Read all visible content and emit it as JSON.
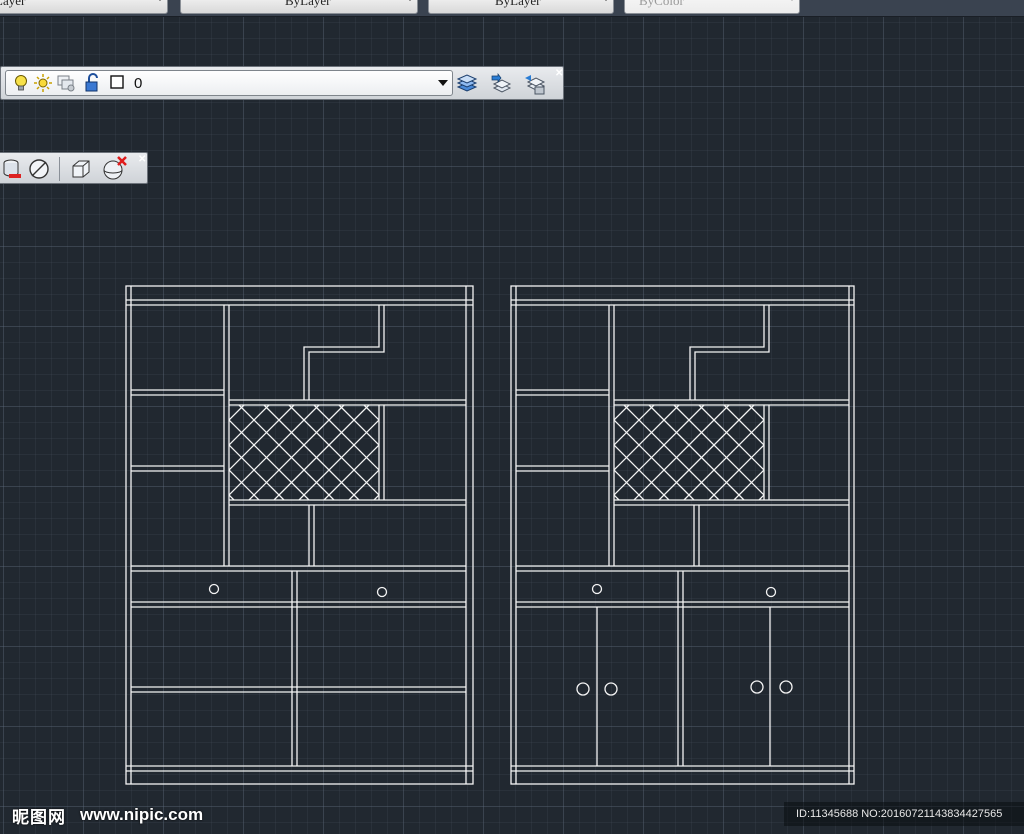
{
  "properties_bar": {
    "color_combo": "Layer",
    "linetype_combo": "ByLayer",
    "lineweight_combo": "ByLayer",
    "plotstyle_combo": "ByColor"
  },
  "layers_toolbar": {
    "current_layer": "0",
    "icons": [
      "layer-on-bulb-icon",
      "thaw-sun-icon",
      "viewport-freeze-icon",
      "lock-open-icon",
      "layer-color-swatch-icon"
    ],
    "buttons": [
      "layer-properties-manager-icon",
      "make-object-layer-current-icon",
      "layer-previous-icon"
    ]
  },
  "solids_toolbar": {
    "buttons": [
      "3d-layer-icon",
      "no-entry-icon",
      "box-3d-icon",
      "delete-solid-icon"
    ]
  },
  "watermark": {
    "logo": "昵图网",
    "site": "www.nipic.com",
    "id_text": "ID:11345688 NO:20160721143834427565"
  },
  "colors": {
    "canvas": "#212830",
    "linework": "#ffffff",
    "toolbar": "#dde0e4"
  }
}
